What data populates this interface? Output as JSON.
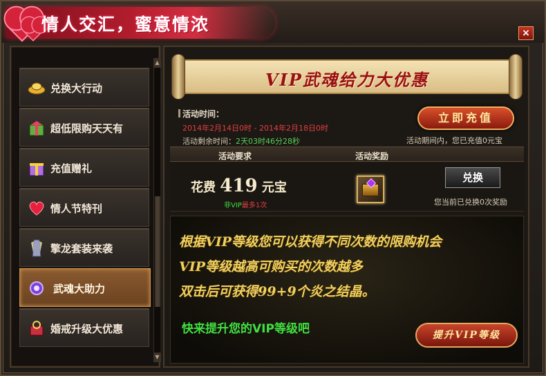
{
  "window": {
    "title": "情人交汇，蜜意情浓",
    "close_icon": "×"
  },
  "sidebar": {
    "items": [
      {
        "label": "兑换大行动",
        "icon": "gold-ingot-icon",
        "active": false
      },
      {
        "label": "超低限购天天有",
        "icon": "gift-box-icon",
        "active": false
      },
      {
        "label": "充值赠礼",
        "icon": "gift-icon",
        "active": false
      },
      {
        "label": "情人节特刊",
        "icon": "heart-icon",
        "active": false
      },
      {
        "label": "擎龙套装来袭",
        "icon": "armor-icon",
        "active": true
      },
      {
        "label": "武魂大助力",
        "icon": "spirit-orb-icon",
        "active": true
      },
      {
        "label": "婚戒升级大优惠",
        "icon": "ring-box-icon",
        "active": false
      }
    ]
  },
  "banner": {
    "text": "VIP武魂给力大优惠"
  },
  "event": {
    "time_title": "活动时间：",
    "time_range": "2014年2月14日0时 - 2014年2月18日0时",
    "remain_label": "活动剩余时间：",
    "remain_value": "2天03时46分28秒",
    "recharge_button": "立即充值",
    "recharged_note": "活动期间内，您已充值0元宝"
  },
  "table": {
    "headers": [
      "活动要求",
      "活动奖励"
    ],
    "row": {
      "cost_prefix": "花费",
      "cost_amount": "419",
      "cost_suffix": "元宝",
      "limit_green": "非VIP",
      "limit_red": "最多1次",
      "exchange_button": "兑换",
      "exchanged_note": "您当前已兑换0次奖励"
    }
  },
  "description": {
    "lines": [
      "根据VIP等级您可以获得不同次数的限购机会",
      "VIP等级越高可购买的次数越多",
      "双击后可获得99+9个炎之结晶。"
    ],
    "cta": "快来提升您的VIP等级吧",
    "vip_button": "提升VIP等级"
  },
  "colors": {
    "accent_red": "#e04040",
    "accent_green": "#40e040",
    "gold_text": "#f2d060"
  }
}
